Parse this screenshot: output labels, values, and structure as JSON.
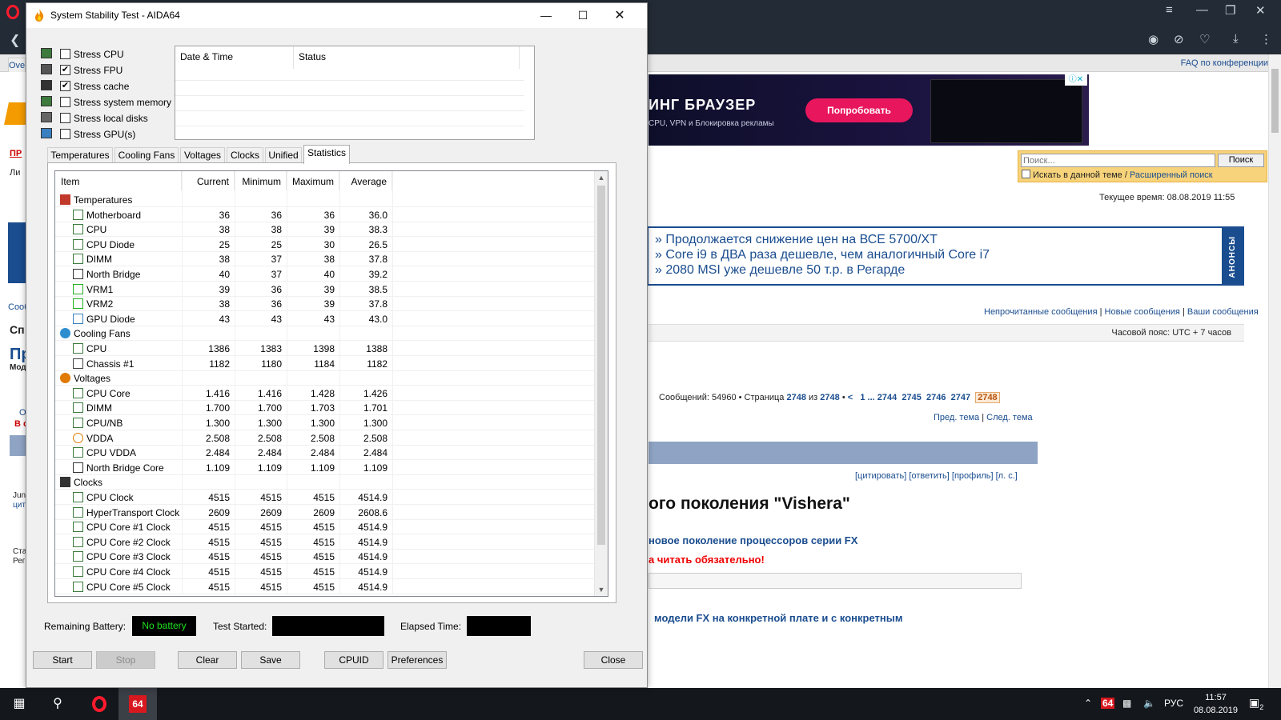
{
  "browser": {
    "tab_label": "Ove",
    "faq": "FAQ по конференции",
    "ad": {
      "title": "ИНГ БРАУЗЕР",
      "subtitle": "CPU, VPN и Блокировка рекламы",
      "button": "Попробовать",
      "close": "ⓘ✕"
    },
    "search": {
      "placeholder": "Поиск...",
      "button": "Поиск",
      "in_topic": "Искать в данной теме",
      "advanced": "Расширенный поиск"
    },
    "time_label": "Текущее время: 08.08.2019 11:55",
    "announce_tab": "АНОНСЫ",
    "news": [
      "Продолжается снижение цен на ВСЕ 5700/XT",
      "Core i9 в ДВА раза дешевле, чем аналогичный Core i7",
      "2080 MSI уже дешевле 50 т.р. в Регарде"
    ],
    "links": {
      "unread": "Непрочитанные сообщения",
      "new": "Новые сообщения",
      "yours": "Ваши сообщения"
    },
    "timezone": "Часовой пояс: UTC + 7 часов",
    "page_nav": {
      "prefix": "Сообщений: 54960 • Страница",
      "page": "2748",
      "of": "из",
      "total": "2748",
      "pages": [
        "1",
        "...",
        "2744",
        "2745",
        "2746",
        "2747"
      ],
      "current": "2748",
      "back": "<"
    },
    "topic_nav": {
      "prev": "Пред. тема",
      "next": "След. тема"
    },
    "post_actions": "[цитировать] [ответить] [профиль] [л. с.]",
    "post_title": "ого поколения \"Vishera\"",
    "post_line1": "новое поколение процессоров серии FX",
    "post_line2": "а читать обязательно!",
    "post_line3": "модели FX на конкретной плате и с конкретным",
    "left_fragments": [
      "ПР",
      "Ли",
      "Сооб",
      "Сп",
      "Пр",
      "Мод",
      "О",
      "В с",
      "Jun",
      "цит",
      "Ста",
      "Рег"
    ]
  },
  "taskbar": {
    "lang": "РУС",
    "time": "11:57",
    "date": "08.08.2019",
    "notifications": "2",
    "aida_label": "64"
  },
  "aida": {
    "title": "System Stability Test - AIDA64",
    "stress_options": [
      {
        "label": "Stress CPU",
        "checked": false
      },
      {
        "label": "Stress FPU",
        "checked": true
      },
      {
        "label": "Stress cache",
        "checked": true
      },
      {
        "label": "Stress system memory",
        "checked": false
      },
      {
        "label": "Stress local disks",
        "checked": false
      },
      {
        "label": "Stress GPU(s)",
        "checked": false
      }
    ],
    "log_columns": [
      "Date & Time",
      "Status"
    ],
    "tabs": [
      "Temperatures",
      "Cooling Fans",
      "Voltages",
      "Clocks",
      "Unified",
      "Statistics"
    ],
    "active_tab": "Statistics",
    "stats_columns": [
      "Item",
      "Current",
      "Minimum",
      "Maximum",
      "Average"
    ],
    "stats_rows": [
      {
        "type": "group",
        "name": "Temperatures",
        "icon": "thermometer-icon"
      },
      {
        "type": "item",
        "name": "Motherboard",
        "icon": "motherboard-icon",
        "cur": "36",
        "min": "36",
        "max": "36",
        "avg": "36.0"
      },
      {
        "type": "item",
        "name": "CPU",
        "icon": "cpu-icon",
        "cur": "38",
        "min": "38",
        "max": "39",
        "avg": "38.3"
      },
      {
        "type": "item",
        "name": "CPU Diode",
        "icon": "cpu-icon",
        "cur": "25",
        "min": "25",
        "max": "30",
        "avg": "26.5"
      },
      {
        "type": "item",
        "name": "DIMM",
        "icon": "memory-icon",
        "cur": "38",
        "min": "37",
        "max": "38",
        "avg": "37.8"
      },
      {
        "type": "item",
        "name": "North Bridge",
        "icon": "chip-icon",
        "cur": "40",
        "min": "37",
        "max": "40",
        "avg": "39.2"
      },
      {
        "type": "item",
        "name": "VRM1",
        "icon": "vrm-icon",
        "cur": "39",
        "min": "36",
        "max": "39",
        "avg": "38.5"
      },
      {
        "type": "item",
        "name": "VRM2",
        "icon": "vrm-icon",
        "cur": "38",
        "min": "36",
        "max": "39",
        "avg": "37.8"
      },
      {
        "type": "item",
        "name": "GPU Diode",
        "icon": "monitor-icon",
        "cur": "43",
        "min": "43",
        "max": "43",
        "avg": "43.0"
      },
      {
        "type": "group",
        "name": "Cooling Fans",
        "icon": "fan-icon"
      },
      {
        "type": "item",
        "name": "CPU",
        "icon": "cpu-icon",
        "cur": "1386",
        "min": "1383",
        "max": "1398",
        "avg": "1388"
      },
      {
        "type": "item",
        "name": "Chassis #1",
        "icon": "case-icon",
        "cur": "1182",
        "min": "1180",
        "max": "1184",
        "avg": "1182"
      },
      {
        "type": "group",
        "name": "Voltages",
        "icon": "voltage-icon"
      },
      {
        "type": "item",
        "name": "CPU Core",
        "icon": "cpu-icon",
        "cur": "1.416",
        "min": "1.416",
        "max": "1.428",
        "avg": "1.426"
      },
      {
        "type": "item",
        "name": "DIMM",
        "icon": "memory-icon",
        "cur": "1.700",
        "min": "1.700",
        "max": "1.703",
        "avg": "1.701"
      },
      {
        "type": "item",
        "name": "CPU/NB",
        "icon": "cpu-icon",
        "cur": "1.300",
        "min": "1.300",
        "max": "1.300",
        "avg": "1.300"
      },
      {
        "type": "item",
        "name": "VDDA",
        "icon": "voltage-icon",
        "cur": "2.508",
        "min": "2.508",
        "max": "2.508",
        "avg": "2.508"
      },
      {
        "type": "item",
        "name": "CPU VDDA",
        "icon": "cpu-icon",
        "cur": "2.484",
        "min": "2.484",
        "max": "2.484",
        "avg": "2.484"
      },
      {
        "type": "item",
        "name": "North Bridge Core",
        "icon": "chip-icon",
        "cur": "1.109",
        "min": "1.109",
        "max": "1.109",
        "avg": "1.109"
      },
      {
        "type": "group",
        "name": "Clocks",
        "icon": "clock-chip-icon"
      },
      {
        "type": "item",
        "name": "CPU Clock",
        "icon": "cpu-icon",
        "cur": "4515",
        "min": "4515",
        "max": "4515",
        "avg": "4514.9"
      },
      {
        "type": "item",
        "name": "HyperTransport Clock",
        "icon": "cpu-icon",
        "cur": "2609",
        "min": "2609",
        "max": "2609",
        "avg": "2608.6"
      },
      {
        "type": "item",
        "name": "CPU Core #1 Clock",
        "icon": "cpu-icon",
        "cur": "4515",
        "min": "4515",
        "max": "4515",
        "avg": "4514.9"
      },
      {
        "type": "item",
        "name": "CPU Core #2 Clock",
        "icon": "cpu-icon",
        "cur": "4515",
        "min": "4515",
        "max": "4515",
        "avg": "4514.9"
      },
      {
        "type": "item",
        "name": "CPU Core #3 Clock",
        "icon": "cpu-icon",
        "cur": "4515",
        "min": "4515",
        "max": "4515",
        "avg": "4514.9"
      },
      {
        "type": "item",
        "name": "CPU Core #4 Clock",
        "icon": "cpu-icon",
        "cur": "4515",
        "min": "4515",
        "max": "4515",
        "avg": "4514.9"
      },
      {
        "type": "item",
        "name": "CPU Core #5 Clock",
        "icon": "cpu-icon",
        "cur": "4515",
        "min": "4515",
        "max": "4515",
        "avg": "4514.9"
      }
    ],
    "status": {
      "battery_label": "Remaining Battery:",
      "battery_value": "No battery",
      "started_label": "Test Started:",
      "elapsed_label": "Elapsed Time:"
    },
    "buttons": {
      "start": "Start",
      "stop": "Stop",
      "clear": "Clear",
      "save": "Save",
      "cpuid": "CPUID",
      "preferences": "Preferences",
      "close": "Close"
    }
  }
}
